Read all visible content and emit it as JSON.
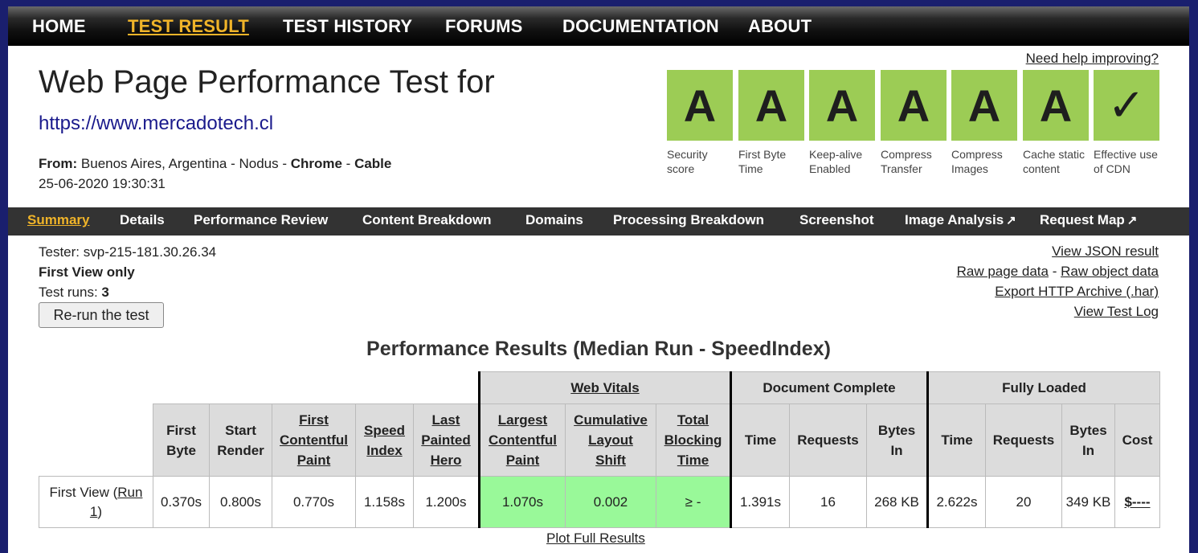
{
  "nav": {
    "items": [
      "HOME",
      "TEST RESULT",
      "TEST HISTORY",
      "FORUMS",
      "DOCUMENTATION",
      "ABOUT"
    ]
  },
  "header": {
    "title": "Web Page Performance Test for",
    "url": "https://www.mercadotech.cl",
    "from_label": "From:",
    "from_text": " Buenos Aires, Argentina - Nodus - ",
    "browser": "Chrome",
    "sep": " - ",
    "connection": "Cable",
    "date": "25-06-2020 19:30:31",
    "help_link": "Need help improving?"
  },
  "grades": [
    {
      "grade": "A",
      "label": "Security score"
    },
    {
      "grade": "A",
      "label": "First Byte Time"
    },
    {
      "grade": "A",
      "label": "Keep-alive Enabled"
    },
    {
      "grade": "A",
      "label": "Compress Transfer"
    },
    {
      "grade": "A",
      "label": "Compress Images"
    },
    {
      "grade": "A",
      "label": "Cache static content"
    },
    {
      "grade": "✓",
      "label": "Effective use of CDN"
    }
  ],
  "subnav": {
    "items": [
      "Summary",
      "Details",
      "Performance Review",
      "Content Breakdown",
      "Domains",
      "Processing Breakdown",
      "Screenshot",
      "Image Analysis",
      "Request Map"
    ],
    "ext_icon": "↗"
  },
  "info": {
    "tester": "Tester: svp-215-181.30.26.34",
    "view": "First View only",
    "runs_label": "Test runs: ",
    "runs": "3",
    "rerun_button": "Re-run the test"
  },
  "links": {
    "json": "View JSON result",
    "raw_page": "Raw page data",
    "dash": " - ",
    "raw_object": "Raw object data",
    "har": "Export HTTP Archive (.har)",
    "log": "View Test Log"
  },
  "results": {
    "title": "Performance Results (Median Run - SpeedIndex)",
    "groups": {
      "web_vitals": "Web Vitals",
      "doc_complete": "Document Complete",
      "fully_loaded": "Fully Loaded"
    },
    "headers": {
      "first_byte": [
        "First",
        "Byte"
      ],
      "start_render": [
        "Start",
        "Render"
      ],
      "fcp": [
        "First",
        "Contentful",
        "Paint"
      ],
      "speed_index": [
        "Speed",
        "Index"
      ],
      "lph": [
        "Last",
        "Painted",
        "Hero"
      ],
      "lcp": [
        "Largest",
        "Contentful",
        "Paint"
      ],
      "cls": [
        "Cumulative",
        "Layout",
        "Shift"
      ],
      "tbt": [
        "Total",
        "Blocking",
        "Time"
      ],
      "time": "Time",
      "requests": "Requests",
      "bytes_in": [
        "Bytes",
        "In"
      ],
      "cost": "Cost"
    },
    "row": {
      "label": "First View (",
      "run_link": "Run 1",
      "label_end": ")",
      "first_byte": "0.370s",
      "start_render": "0.800s",
      "fcp": "0.770s",
      "speed_index": "1.158s",
      "lph": "1.200s",
      "lcp": "1.070s",
      "cls": "0.002",
      "tbt": "≥ -",
      "doc_time": "1.391s",
      "doc_requests": "16",
      "doc_bytes": "268 KB",
      "full_time": "2.622s",
      "full_requests": "20",
      "full_bytes": "349 KB",
      "cost": "$----"
    },
    "plot_link": "Plot Full Results"
  }
}
